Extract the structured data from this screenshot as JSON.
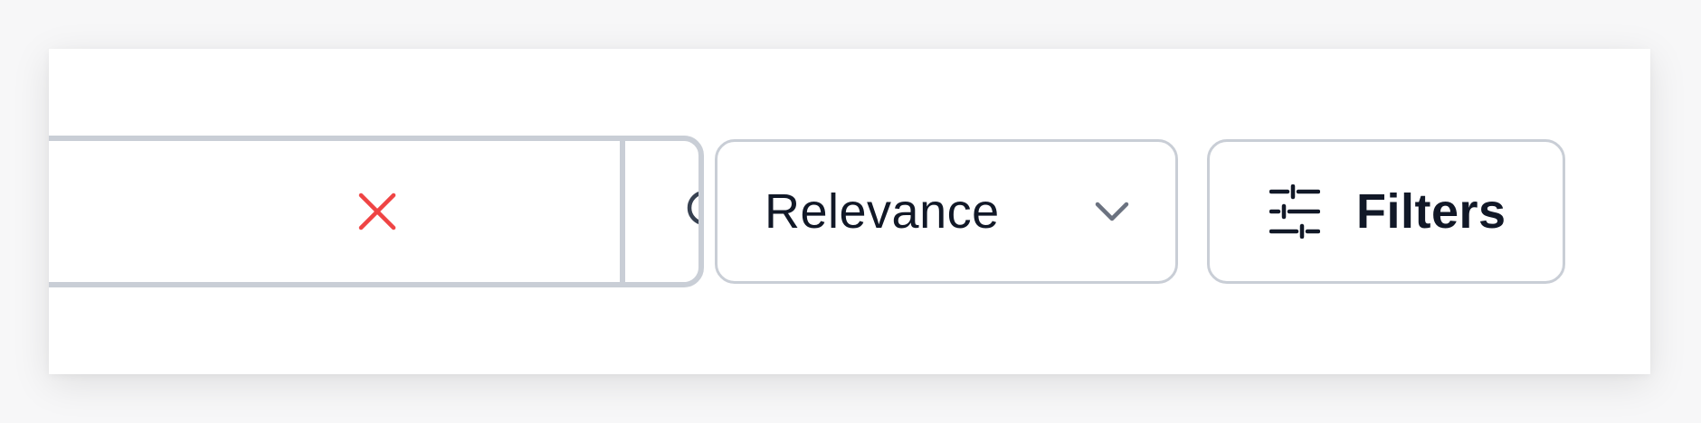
{
  "search": {
    "value": "",
    "placeholder": "",
    "clear_icon": "close-icon",
    "submit_icon": "search-icon"
  },
  "sort": {
    "selected": "Relevance",
    "icon": "chevron-down-icon"
  },
  "filters": {
    "label": "Filters",
    "icon": "sliders-icon"
  },
  "colors": {
    "border": "#c9ced6",
    "text": "#111827",
    "clear": "#ef4444",
    "chevron": "#6b7280"
  }
}
